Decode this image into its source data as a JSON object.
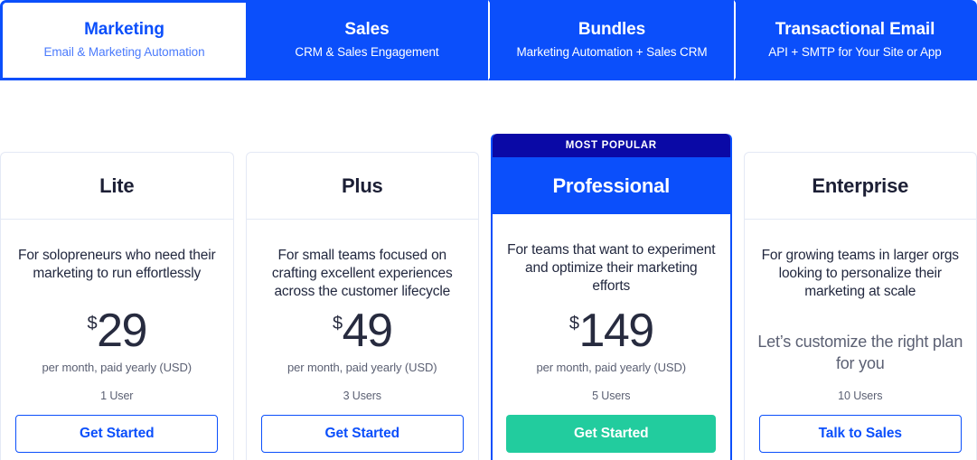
{
  "colors": {
    "brand_blue": "#0B4FFB",
    "ribbon_navy": "#0A09A6",
    "cta_green": "#22CC9E",
    "card_border": "#e4e9f5",
    "text_dark": "#22283f",
    "text_muted": "#5b6073"
  },
  "tabs": [
    {
      "title": "Marketing",
      "subtitle": "Email & Marketing Automation",
      "active": true
    },
    {
      "title": "Sales",
      "subtitle": "CRM & Sales Engagement",
      "active": false
    },
    {
      "title": "Bundles",
      "subtitle": "Marketing Automation + Sales CRM",
      "active": false
    },
    {
      "title": "Transactional Email",
      "subtitle": "API + SMTP for Your Site or App",
      "active": false
    }
  ],
  "plans": [
    {
      "name": "Lite",
      "description": "For solopreneurs who need their marketing to run effortlessly",
      "currency": "$",
      "amount": "29",
      "price_note": "per month, paid yearly (USD)",
      "users": "1 User",
      "cta_label": "Get Started",
      "badge": null
    },
    {
      "name": "Plus",
      "description": "For small teams focused on crafting excellent experiences across the customer lifecycle",
      "currency": "$",
      "amount": "49",
      "price_note": "per month, paid yearly (USD)",
      "users": "3 Users",
      "cta_label": "Get Started",
      "badge": null
    },
    {
      "name": "Professional",
      "description": "For teams that want to experiment and optimize their marketing efforts",
      "currency": "$",
      "amount": "149",
      "price_note": "per month, paid yearly (USD)",
      "users": "5 Users",
      "cta_label": "Get Started",
      "badge": "MOST POPULAR"
    },
    {
      "name": "Enterprise",
      "description": "For growing teams in larger orgs looking to personalize their marketing at scale",
      "custom_price": "Let’s customize the right plan for you",
      "users": "10 Users",
      "cta_label": "Talk to Sales",
      "badge": null
    }
  ]
}
